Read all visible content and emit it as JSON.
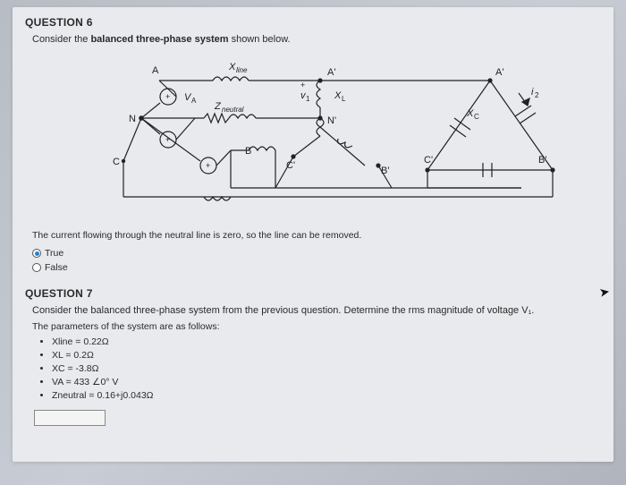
{
  "q6": {
    "title": "QUESTION 6",
    "prompt_pre": "Consider the ",
    "prompt_bold": "balanced three-phase system",
    "prompt_post": " shown below.",
    "statement": "The current flowing through the neutral line is zero, so the line can be removed.",
    "opt_true": "True",
    "opt_false": "False"
  },
  "diagram": {
    "A": "A",
    "B": "B",
    "C": "C",
    "N": "N",
    "Ap": "A'",
    "Bp": "B'",
    "Cp": "C'",
    "Np": "N'",
    "Ap2": "A'",
    "Bp2": "B'",
    "Cp2": "C'",
    "VA": "V",
    "VA_sub": "A",
    "Xline": "X",
    "Xline_sub": "line",
    "Zneu": "Z",
    "Zneu_sub": "neutral",
    "v1": "v",
    "v1_sub": "1",
    "XL": "X",
    "XL_sub": "L",
    "XC": "X",
    "XC_sub": "C",
    "i2": "i",
    "i2_sub": "2",
    "plus": "+"
  },
  "q7": {
    "title": "QUESTION 7",
    "prompt": "Consider the balanced three-phase system from the previous question. Determine the rms magnitude of voltage V₁.",
    "sub": "The parameters of the system are as follows:",
    "p1": "Xline = 0.22Ω",
    "p2": "XL = 0.2Ω",
    "p3": "XC = -3.8Ω",
    "p4": "VA = 433 ∠0° V",
    "p5": "Zneutral = 0.16+j0.043Ω"
  }
}
